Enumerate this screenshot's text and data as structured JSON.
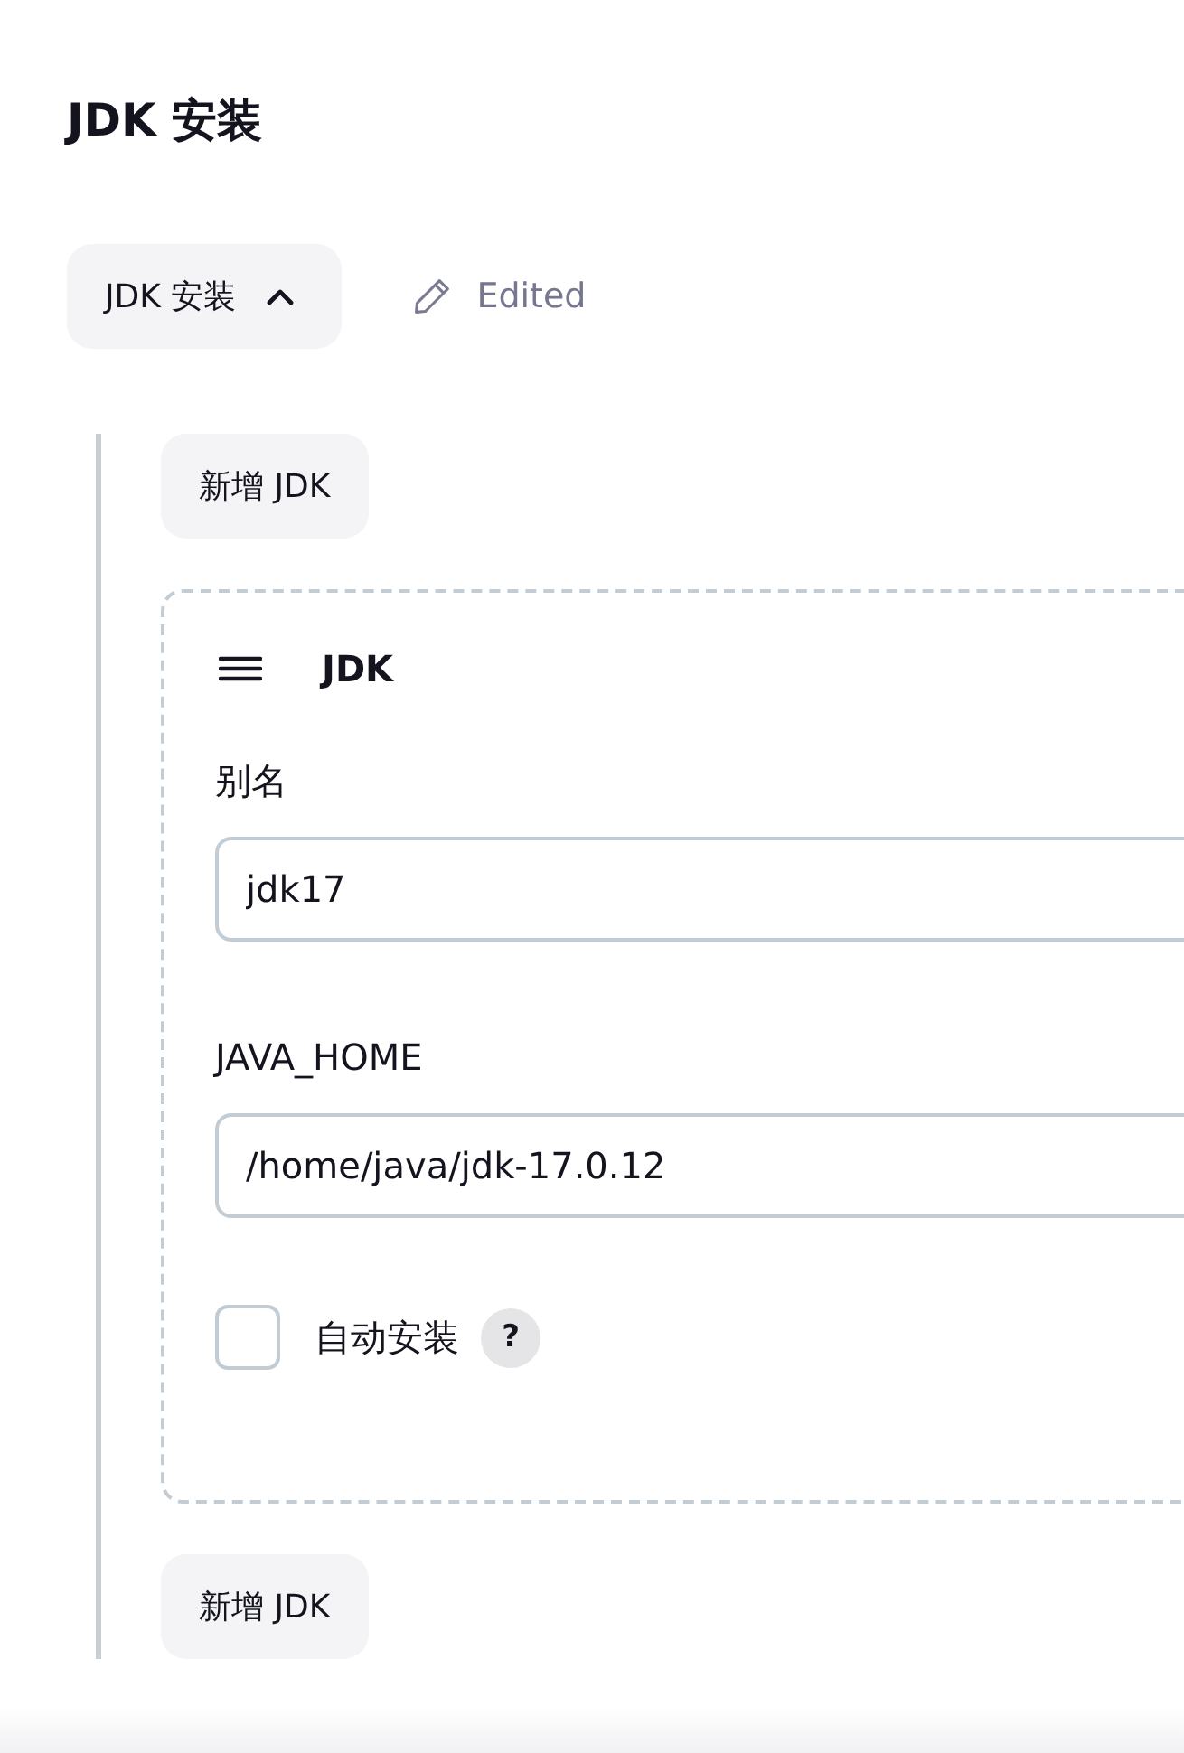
{
  "page_title": "JDK 安装",
  "section_toggle": {
    "label": "JDK 安装",
    "expanded": true
  },
  "status": {
    "label": "Edited"
  },
  "add_button_top": {
    "label": "新增 JDK"
  },
  "installations": [
    {
      "title": "JDK",
      "fields": [
        {
          "label": "别名",
          "value": "jdk17"
        },
        {
          "label": "JAVA_HOME",
          "value": "/home/java/jdk-17.0.12"
        }
      ],
      "auto_install": {
        "label": "自动安装",
        "checked": false,
        "help": "?"
      }
    }
  ],
  "add_button_bottom": {
    "label": "新增 JDK"
  }
}
